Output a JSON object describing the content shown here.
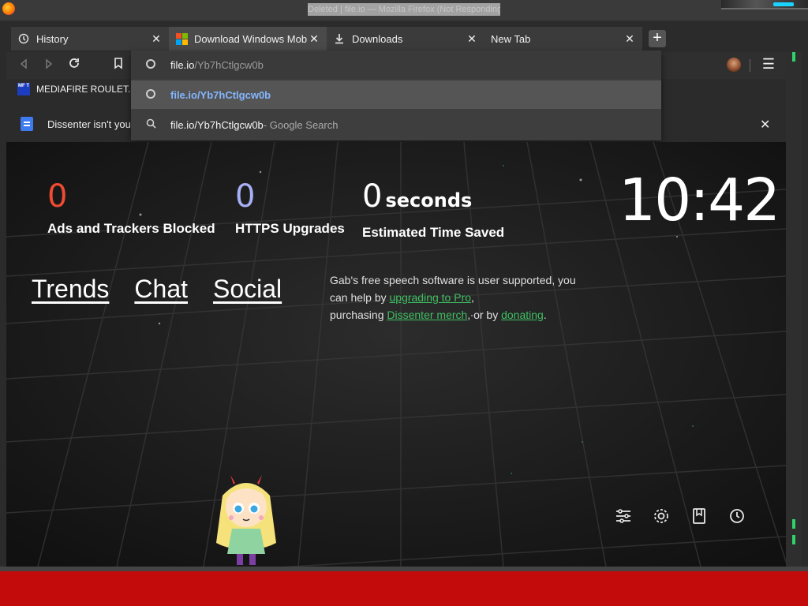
{
  "window": {
    "title": "Deleted | file.io — Mozilla Firefox (Not Responding)"
  },
  "tabs": [
    {
      "label": "History",
      "icon": "history-icon"
    },
    {
      "label": "Download Windows Mobile",
      "icon": "microsoft-logo-icon"
    },
    {
      "label": "Downloads",
      "icon": "download-icon"
    },
    {
      "label": "New Tab",
      "icon": ""
    }
  ],
  "urlbar": {
    "domain": "file.io",
    "path": "/Yb7hCtlgcw0b",
    "suggestions": [
      {
        "text": "file.io/Yb7hCtlgcw0b",
        "icon": "globe-icon"
      },
      {
        "text": "file.io/Yb7hCtlgcw0b",
        "suffix": " - Google Search",
        "icon": "search-icon"
      }
    ]
  },
  "bookmarks": [
    {
      "label": "MEDIAFIRE ROULET...",
      "icon_text": "MF T"
    }
  ],
  "notification": {
    "message": "Dissenter isn't you"
  },
  "stats": [
    {
      "value": "0",
      "label": "Ads and Trackers Blocked",
      "color": "#ef4b32"
    },
    {
      "value": "0",
      "label": "HTTPS Upgrades",
      "color": "#a8b0f5"
    },
    {
      "value": "0",
      "unit": "seconds",
      "label": "Estimated Time Saved",
      "color": "#ffffff"
    }
  ],
  "clock": "10:42",
  "links": [
    "Trends",
    "Chat",
    "Social"
  ],
  "support": {
    "line1": "Gab's free speech software is user supported, you",
    "line2_pre": "can help by ",
    "line2_link": "upgrading to Pro",
    "line2_post": ",",
    "line3_pre": "purchasing ",
    "line3_link1": "Dissenter merch",
    "line3_mid": ", or by ",
    "line3_link2": "donating",
    "line3_post": "."
  },
  "tools": [
    "sliders-icon",
    "gear-icon",
    "bookmark-icon",
    "history-icon"
  ],
  "colors": {
    "accent_red": "#ef4b32",
    "accent_blue": "#a8b0f5",
    "link_green": "#3fbf62",
    "taskbar_red": "#c40b0b"
  }
}
